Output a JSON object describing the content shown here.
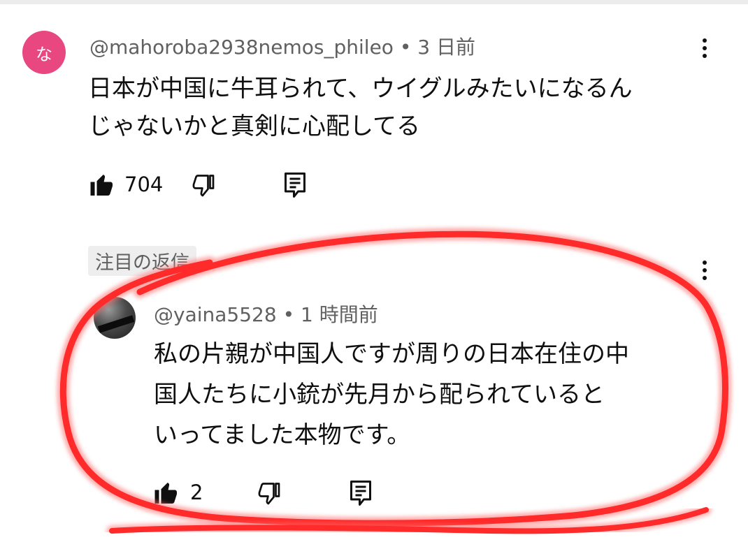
{
  "top_comment": {
    "avatar_letter": "な",
    "author": "@mahoroba2938nemos_phileo",
    "time": "3 日前",
    "text_line1": "日本が中国に牛耳られて、ウイグルみたいになるん",
    "text_line2": "じゃないかと真剣に心配してる",
    "likes": "704"
  },
  "reply_section": {
    "label": "注目の返信"
  },
  "reply": {
    "author": "@yaina5528",
    "time": "1 時間前",
    "text_line1": "私の片親が中国人ですが周りの日本在住の中",
    "text_line2": "国人たちに小銃が先月から配られていると",
    "text_line3": "いってました本物です。",
    "likes": "2"
  },
  "colors": {
    "avatar_bg": "#e8477f",
    "annotation": "#ff2a2a"
  },
  "icons": [
    "like-icon",
    "dislike-icon",
    "reply-icon",
    "more-options-icon"
  ]
}
